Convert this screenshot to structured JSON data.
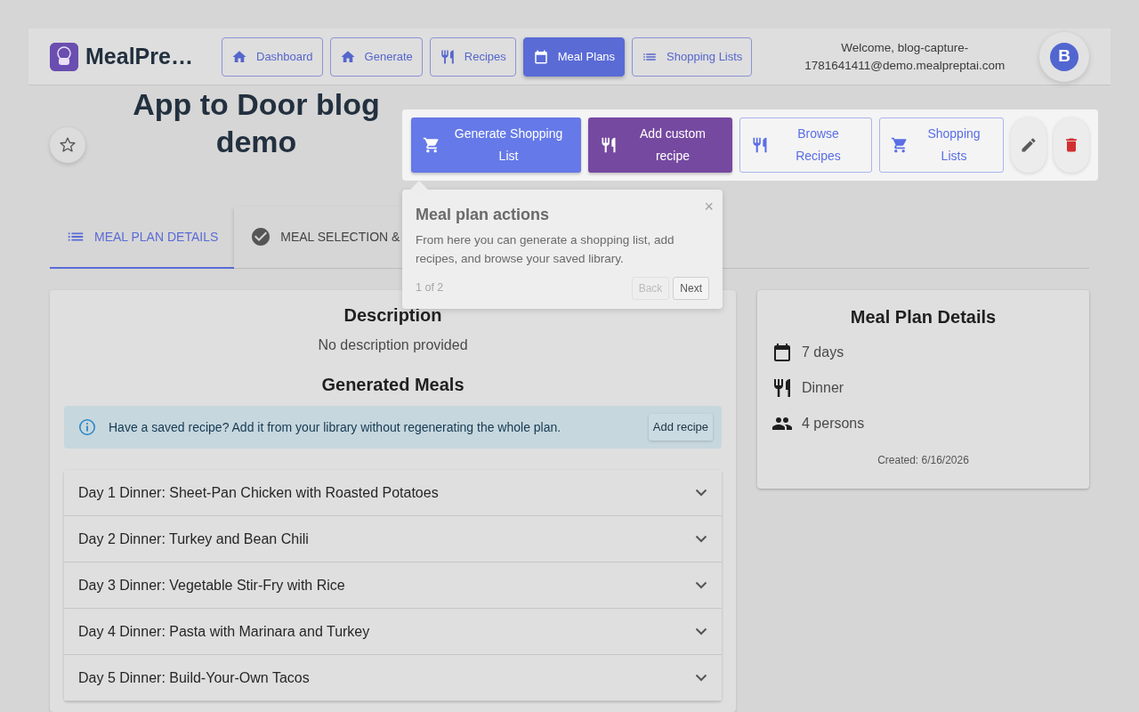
{
  "app": {
    "name": "MealPre…"
  },
  "nav": [
    {
      "label": "Dashboard",
      "selected": false
    },
    {
      "label": "Generate",
      "selected": false
    },
    {
      "label": "Recipes",
      "selected": false
    },
    {
      "label": "Meal Plans",
      "selected": true
    },
    {
      "label": "Shopping Lists",
      "selected": false
    }
  ],
  "welcome": "Welcome, blog-capture-1781641411@demo.mealpreptai.com",
  "avatar": "B",
  "starred": false,
  "title": "App to Door blog demo",
  "actions": [
    {
      "label": "Generate Shopping List",
      "kind": "primary"
    },
    {
      "label": "Add custom recipe",
      "kind": "secondary"
    },
    {
      "label": "Browse Recipes",
      "kind": "outline"
    },
    {
      "label": "Shopping Lists",
      "kind": "outline"
    }
  ],
  "tabs": [
    {
      "label": "MEAL PLAN DETAILS",
      "selected": true
    },
    {
      "label": "MEAL SELECTION &",
      "selected": false
    }
  ],
  "tour": {
    "title": "Meal plan actions",
    "body": "From here you can generate a shopping list, add recipes, and browse your saved library.",
    "close": "×",
    "step": "1 of 2",
    "buttons": [
      {
        "label": "Back",
        "disabled": true
      },
      {
        "label": "Next",
        "disabled": false
      }
    ]
  },
  "description": {
    "heading": "Description",
    "text": "No description provided"
  },
  "meals": {
    "heading": "Generated Meals",
    "notice": "Have a saved recipe? Add it from your library without regenerating the whole plan.",
    "notice_button": "Add recipe",
    "items": [
      {
        "label": "Day 1 Dinner: Sheet-Pan Chicken with Roasted Potatoes",
        "expanded": false
      },
      {
        "label": "Day 2 Dinner: Turkey and Bean Chili",
        "expanded": false
      },
      {
        "label": "Day 3 Dinner: Vegetable Stir-Fry with Rice",
        "expanded": false
      },
      {
        "label": "Day 4 Dinner: Pasta with Marinara and Turkey",
        "expanded": false
      },
      {
        "label": "Day 5 Dinner: Build-Your-Own Tacos",
        "expanded": false
      }
    ]
  },
  "details": {
    "heading": "Meal Plan Details",
    "facts": [
      "7 days",
      "Dinner",
      "4 persons"
    ],
    "created": "Created: 6/16/2026"
  }
}
